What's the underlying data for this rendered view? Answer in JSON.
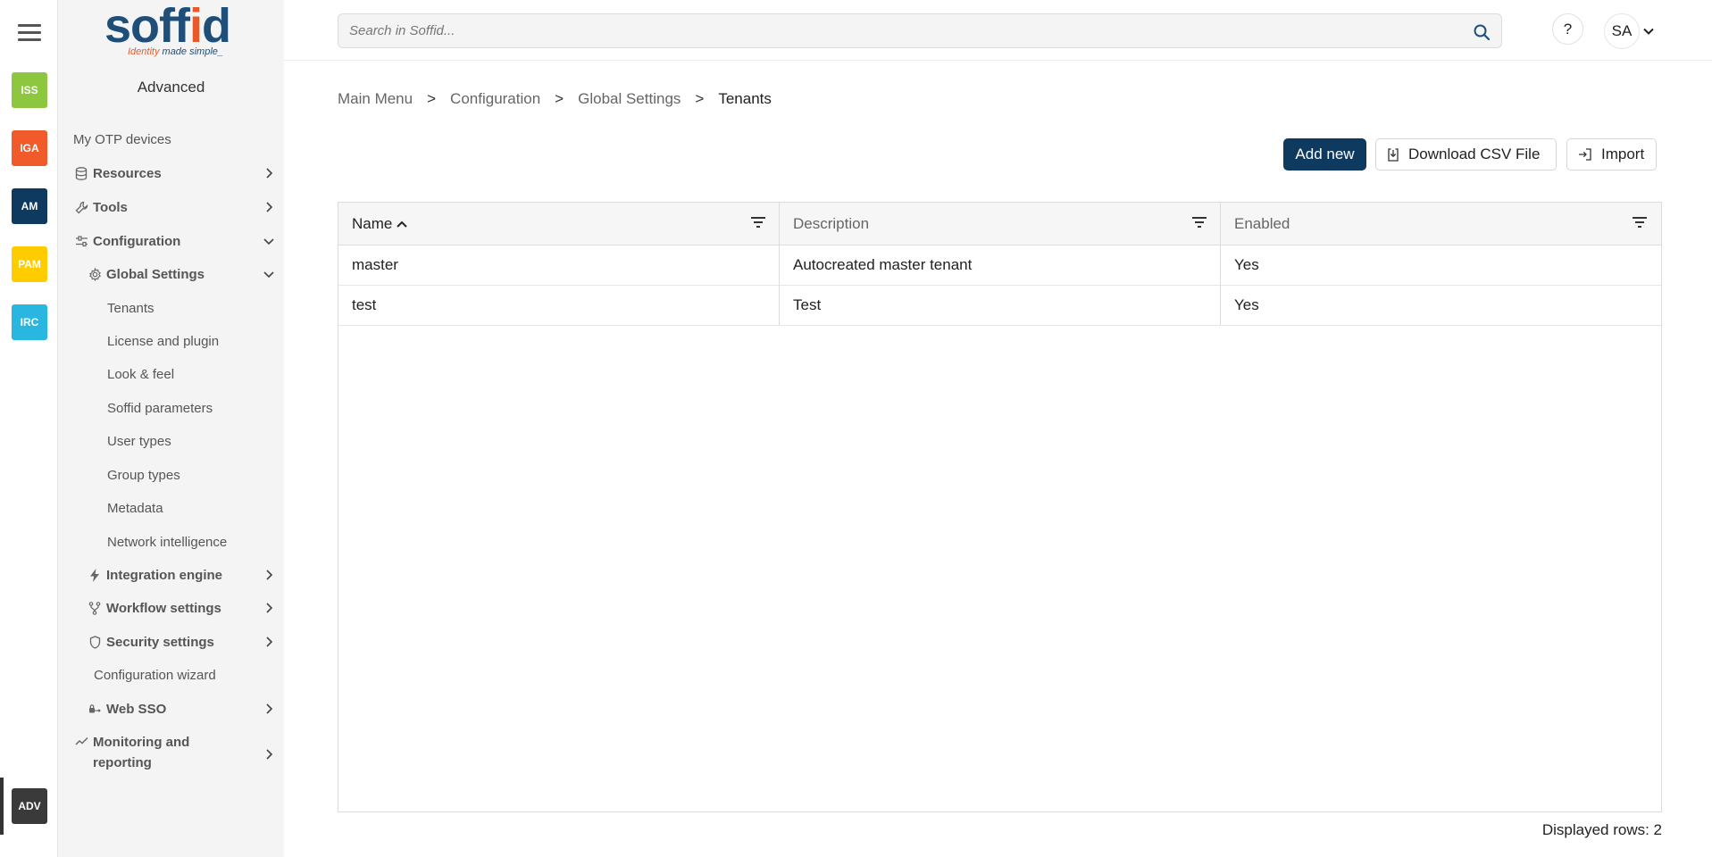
{
  "rail": {
    "modules": [
      {
        "label": "ISS",
        "color": "#8dc63f"
      },
      {
        "label": "IGA",
        "color": "#f15a2b"
      },
      {
        "label": "AM",
        "color": "#0f3a5f"
      },
      {
        "label": "PAM",
        "color": "#ffcc00"
      },
      {
        "label": "IRC",
        "color": "#29b6e0"
      },
      {
        "label": "ADV",
        "color": "#3a3a3a"
      }
    ]
  },
  "brand": {
    "word_a": "soff",
    "word_b": "i",
    "word_c": "d",
    "tag_a": "Identity ",
    "tag_b": "made simple_"
  },
  "sidebar": {
    "title": "Advanced",
    "items": [
      {
        "label": "My OTP devices"
      },
      {
        "label": "Resources",
        "icon": "database-icon"
      },
      {
        "label": "Tools",
        "icon": "wrench-icon"
      },
      {
        "label": "Configuration",
        "icon": "sliders-icon"
      },
      {
        "label": "Global Settings",
        "icon": "gear-icon"
      },
      {
        "label": "Tenants"
      },
      {
        "label": "License and plugin"
      },
      {
        "label": "Look & feel"
      },
      {
        "label": "Soffid parameters"
      },
      {
        "label": "User types"
      },
      {
        "label": "Group types"
      },
      {
        "label": "Metadata"
      },
      {
        "label": "Network intelligence"
      },
      {
        "label": "Integration engine",
        "icon": "bolt-icon"
      },
      {
        "label": "Workflow settings",
        "icon": "fork-icon"
      },
      {
        "label": "Security settings",
        "icon": "shield-icon"
      },
      {
        "label": "Configuration wizard"
      },
      {
        "label": "Web SSO",
        "icon": "key-icon"
      },
      {
        "label": "Monitoring and reporting",
        "icon": "trend-icon"
      }
    ]
  },
  "header": {
    "search_placeholder": "Search in Soffid...",
    "help_label": "?",
    "user_initials": "SA"
  },
  "breadcrumb": {
    "items": [
      "Main Menu",
      "Configuration",
      "Global Settings",
      "Tenants"
    ],
    "separator": ">"
  },
  "actions": {
    "add_new": "Add new",
    "download_csv": "Download CSV File",
    "import": "Import"
  },
  "table": {
    "columns": [
      "Name",
      "Description",
      "Enabled"
    ],
    "sorted_column": "Name",
    "sort_direction": "ascending",
    "rows": [
      [
        "master",
        "Autocreated master tenant",
        "Yes"
      ],
      [
        "test",
        "Test",
        "Yes"
      ]
    ]
  },
  "footer": {
    "displayed_rows": "Displayed rows: 2"
  }
}
